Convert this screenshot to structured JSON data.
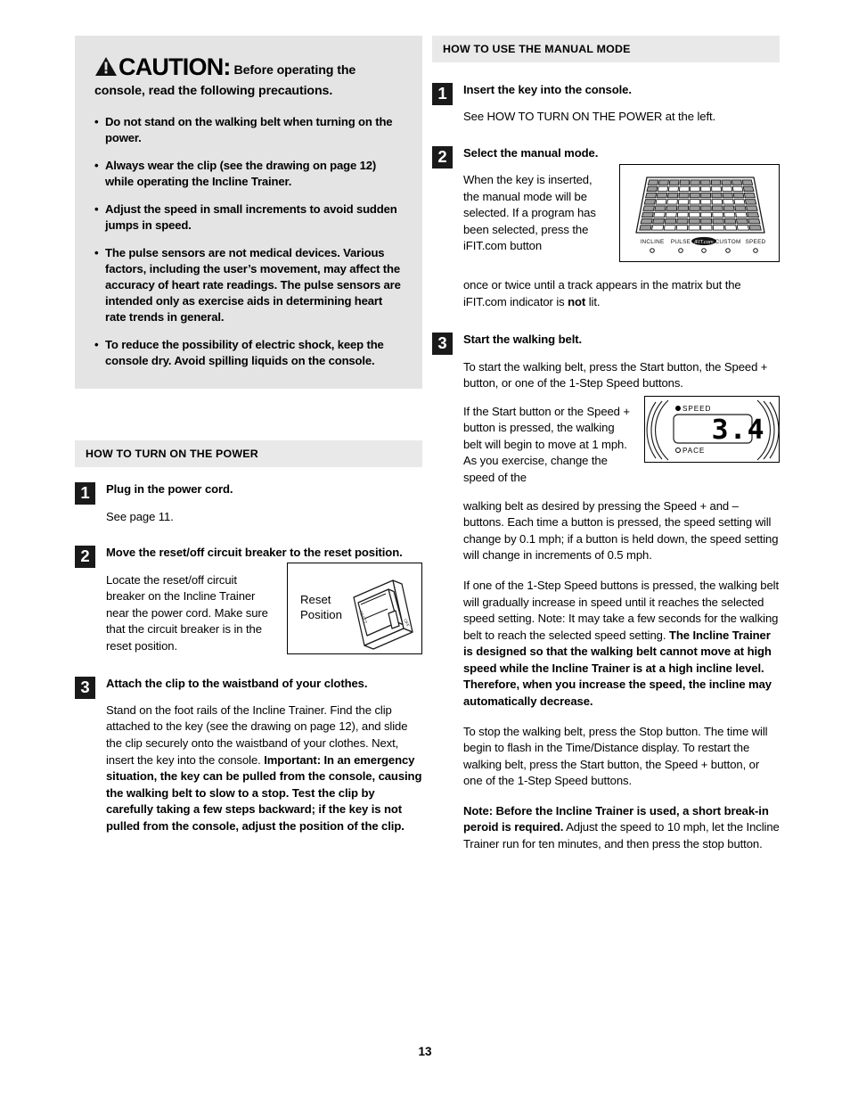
{
  "page": {
    "number": "13"
  },
  "caution": {
    "icon": "warning-triangle-icon",
    "word": "CAUTION:",
    "lead": "Before operating the console, read the following precautions.",
    "lead_part1": "Before operating the",
    "lead_part2": "console, read the following precautions.",
    "bullets": [
      "Do not stand on the walking belt when turning on the power.",
      "Always wear the clip (see the drawing on page 12) while operating the Incline Trainer.",
      "Adjust the speed in small increments to avoid sudden jumps in speed.",
      "The pulse sensors are not medical devices. Various factors, including the user’s movement, may affect the accuracy of heart rate readings. The pulse sensors are intended only as exercise aids in determining heart rate trends in general.",
      "To reduce the possibility of electric shock, keep the console dry. Avoid spilling liquids on the console."
    ]
  },
  "power_section": {
    "header": "HOW TO TURN ON THE POWER",
    "steps": [
      {
        "num": "1",
        "title": "Plug in the power cord.",
        "body": "See page 11."
      },
      {
        "num": "2",
        "title": "Move the reset/off circuit breaker to the reset position.",
        "body": "Locate the reset/off circuit breaker on the Incline Trainer near the power cord. Make sure that the circuit breaker is in the reset position.",
        "figure": {
          "name": "reset-position-figure",
          "label_line1": "Reset",
          "label_line2": "Position"
        }
      },
      {
        "num": "3",
        "title": "Attach the clip to the waistband of your clothes.",
        "body_part1": "Stand on the foot rails of the Incline Trainer. Find the clip attached to the key (see the drawing on page 12), and slide the clip securely onto the waistband of your clothes. Next, insert the key into the console. ",
        "body_bold": "Important: In an emergency situation, the key can be pulled from the console, causing the walking belt to slow to a stop. Test the clip by carefully taking a few steps backward; if the key is not pulled from the console, adjust the position of the clip."
      }
    ]
  },
  "manual_section": {
    "header": "HOW TO USE THE MANUAL MODE",
    "steps": [
      {
        "num": "1",
        "title": "Insert the key into the console.",
        "body": "See HOW TO TURN ON THE POWER at the left."
      },
      {
        "num": "2",
        "title": "Select the manual mode.",
        "body_wrap": "When the key is inserted, the manual mode will be selected. If a program has been selected, press the iFIT.com button",
        "body_after_part1": "once or twice until a track appears in the matrix but the iFIT.com indicator is ",
        "body_after_bold": "not",
        "body_after_part2": " lit.",
        "figure": {
          "name": "matrix-display-figure",
          "labels": [
            "INCLINE",
            "PULSE",
            "iFIT.com",
            "CUSTOM",
            "SPEED"
          ],
          "rows": 8,
          "cols": 10
        }
      },
      {
        "num": "3",
        "title": "Start the walking belt.",
        "para1": "To start the walking belt, press the Start button, the Speed + button, or one of the 1-Step Speed buttons.",
        "para2_wrap": "If the Start button or the Speed + button is pressed, the walking belt will begin to move at 1 mph. As you exercise, change the speed of the",
        "para2_after": "walking belt as desired by pressing the Speed + and – buttons. Each time a button is pressed, the speed setting will change by 0.1 mph; if a button is held down, the speed setting will change in increments of 0.5 mph.",
        "para3_part1": "If one of the 1-Step Speed buttons is pressed, the walking belt will gradually increase in speed until it reaches the selected speed setting. Note: It may take a few seconds for the walking belt to reach the selected speed setting. ",
        "para3_bold": "The Incline Trainer is designed so that the walking belt cannot move at high speed while the Incline Trainer is at a high incline level. Therefore, when you increase the speed, the incline may automatically decrease.",
        "para4": "To stop the walking belt, press the Stop button. The time will begin to flash in the Time/Distance display. To restart the walking belt, press the Start button, the Speed + button, or one of the 1-Step Speed buttons.",
        "para5_bold": "Note: Before the Incline Trainer is used, a short break-in peroid is required.",
        "para5_rest": " Adjust the speed to 10 mph, let the Incline Trainer run for ten minutes, and then press the stop button.",
        "figure": {
          "name": "speed-display-figure",
          "speed_label": "SPEED",
          "pace_label": "PACE",
          "value": "3.4"
        }
      }
    ]
  },
  "colors": {
    "caution_bg": "#e4e4e4",
    "section_header_bg": "#e9e9e9",
    "step_num_bg": "#1a1a1a",
    "text": "#000000"
  }
}
